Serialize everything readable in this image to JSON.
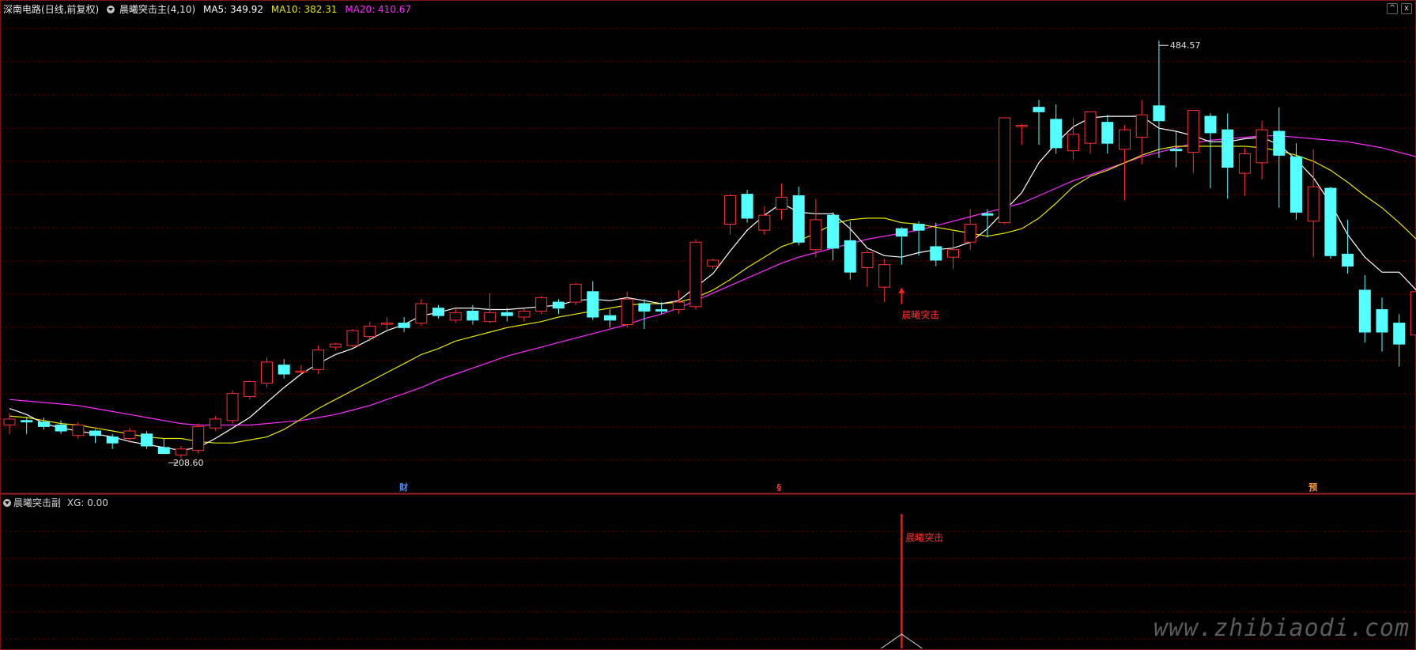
{
  "main_panel": {
    "stock_name": "深南电路",
    "period": "(日线,前复权)",
    "indicator_name": "晨曦突击主",
    "indicator_params": "(4,10)",
    "ma5_label": "MA5: 349.92",
    "ma10_label": "MA10: 382.31",
    "ma20_label": "MA20: 410.67",
    "high_label": "484.57",
    "low_label": "208.60",
    "signal_label": "晨曦突击",
    "markers": [
      {
        "text": "财",
        "color": "#4a8cff",
        "index": 23
      },
      {
        "text": "§",
        "color": "#ff3030",
        "index": 45
      },
      {
        "text": "预",
        "color": "#ff9a30",
        "index": 76
      }
    ],
    "colors": {
      "up": "#ff3030",
      "down": "#54ffff",
      "ma5": "#ffffff",
      "ma10": "#e6e600",
      "ma20": "#ff2cff",
      "grid": "#5a0000"
    }
  },
  "sub_panel": {
    "indicator_name": "晨曦突击副",
    "value_label": "XG: 0.00",
    "signal_label": "晨曦突击"
  },
  "window_buttons": {
    "collapse": "^",
    "close": "x"
  },
  "watermark": "www.zhibiaodi.com",
  "chart_data": {
    "type": "candlestick",
    "y_range": [
      195,
      500
    ],
    "signal_index": 52,
    "candles": [
      [
        228,
        232,
        222,
        236
      ],
      [
        231,
        230,
        222,
        233
      ],
      [
        230,
        227,
        225,
        233
      ],
      [
        228,
        224,
        222,
        231
      ],
      [
        221,
        228,
        219,
        230
      ],
      [
        224,
        221,
        216,
        225
      ],
      [
        220,
        216,
        212,
        222
      ],
      [
        219,
        224,
        216,
        226
      ],
      [
        222,
        214,
        212,
        224
      ],
      [
        213,
        209,
        208.6,
        219
      ],
      [
        208,
        212,
        206,
        214
      ],
      [
        211,
        227,
        209,
        229
      ],
      [
        226,
        232,
        224,
        234
      ],
      [
        231,
        249,
        229,
        251
      ],
      [
        247,
        257,
        245,
        258
      ],
      [
        256,
        270,
        253,
        273
      ],
      [
        268,
        262,
        259,
        272
      ],
      [
        264,
        264,
        262,
        268
      ],
      [
        265,
        278,
        262,
        281
      ],
      [
        280,
        282,
        278,
        283
      ],
      [
        281,
        291,
        280,
        292
      ],
      [
        287,
        294,
        284,
        297
      ],
      [
        296,
        296,
        290,
        300
      ],
      [
        296,
        293,
        290,
        300
      ],
      [
        296,
        309,
        294,
        312
      ],
      [
        306,
        301,
        299,
        308
      ],
      [
        298,
        303,
        296,
        306
      ],
      [
        304,
        298,
        295,
        308
      ],
      [
        297,
        303,
        296,
        316
      ],
      [
        303,
        301,
        297,
        306
      ],
      [
        300,
        304,
        297,
        306
      ],
      [
        304,
        313,
        302,
        314
      ],
      [
        310,
        306,
        302,
        312
      ],
      [
        310,
        322,
        308,
        323
      ],
      [
        317,
        300,
        298,
        324
      ],
      [
        301,
        298,
        293,
        305
      ],
      [
        295,
        312,
        293,
        317
      ],
      [
        309,
        304,
        292,
        312
      ],
      [
        305,
        304,
        302,
        310
      ],
      [
        305,
        310,
        302,
        318
      ],
      [
        307,
        350,
        305,
        352
      ],
      [
        334,
        338,
        332,
        339
      ],
      [
        362,
        381,
        355,
        382
      ],
      [
        382,
        366,
        363,
        385
      ],
      [
        358,
        368,
        355,
        374
      ],
      [
        372,
        380,
        365,
        389
      ],
      [
        381,
        350,
        348,
        387
      ],
      [
        345,
        365,
        340,
        379
      ],
      [
        368,
        346,
        338,
        370
      ],
      [
        351,
        330,
        325,
        364
      ],
      [
        333,
        343,
        320,
        345
      ],
      [
        320,
        335,
        310,
        339
      ],
      [
        359,
        354,
        335,
        360
      ],
      [
        362,
        358,
        341,
        364
      ],
      [
        347,
        338,
        334,
        363
      ],
      [
        340,
        345,
        332,
        357
      ],
      [
        350,
        362,
        345,
        372
      ],
      [
        369,
        368,
        353,
        372
      ],
      [
        363,
        433,
        362,
        433
      ],
      [
        428,
        428,
        415,
        429
      ],
      [
        440,
        437,
        415,
        445
      ],
      [
        432,
        413,
        409,
        442
      ],
      [
        411,
        422,
        405,
        433
      ],
      [
        416,
        437,
        409,
        437
      ],
      [
        430,
        416,
        409,
        435
      ],
      [
        412,
        425,
        378,
        428
      ],
      [
        420,
        435,
        402,
        445
      ],
      [
        441,
        431,
        406,
        484.57
      ],
      [
        412,
        411,
        400,
        424
      ],
      [
        410,
        438,
        396,
        438
      ],
      [
        434,
        423,
        386,
        436
      ],
      [
        425,
        400,
        379,
        436
      ],
      [
        396,
        409,
        381,
        413
      ],
      [
        403,
        425,
        392,
        431
      ],
      [
        424,
        408,
        373,
        440
      ],
      [
        407,
        370,
        365,
        416
      ],
      [
        364,
        387,
        340,
        412
      ],
      [
        386,
        341,
        339,
        387
      ],
      [
        342,
        334,
        329,
        365
      ],
      [
        318,
        290,
        283,
        328
      ],
      [
        305,
        290,
        277,
        313
      ],
      [
        296,
        282,
        267,
        302
      ],
      [
        288,
        317,
        250,
        313
      ]
    ],
    "ma5": [
      239,
      235,
      229,
      226,
      224,
      222,
      220,
      217,
      215,
      213,
      211,
      213,
      219,
      226,
      233,
      243,
      253,
      262,
      269,
      275,
      279,
      285,
      291,
      295,
      301,
      303,
      306,
      306,
      305,
      305,
      306,
      307,
      308,
      311,
      312,
      311,
      313,
      311,
      309,
      311,
      320,
      329,
      344,
      358,
      368,
      376,
      370,
      369,
      369,
      359,
      346,
      341,
      340,
      343,
      345,
      346,
      350,
      359,
      371,
      383,
      403,
      416,
      427,
      433,
      434,
      434,
      434,
      426,
      424,
      421,
      417,
      417,
      419,
      420,
      415,
      405,
      393,
      376,
      355,
      340,
      330,
      330,
      318
    ],
    "ma10": [
      234,
      233,
      231,
      229,
      228,
      226,
      224,
      222,
      220,
      219,
      219,
      217,
      216,
      216,
      218,
      220,
      225,
      232,
      239,
      245,
      251,
      257,
      263,
      269,
      275,
      279,
      284,
      287,
      290,
      293,
      295,
      297,
      300,
      302,
      304,
      306,
      308,
      309,
      309,
      310,
      313,
      318,
      325,
      333,
      340,
      347,
      351,
      356,
      362,
      365,
      366,
      366,
      363,
      362,
      360,
      358,
      356,
      354,
      356,
      359,
      366,
      376,
      387,
      394,
      398,
      403,
      408,
      412,
      414,
      414,
      414,
      414,
      414,
      413,
      411,
      408,
      404,
      398,
      390,
      381,
      373,
      363,
      352
    ],
    "ma20": [
      245,
      244,
      243,
      242,
      241,
      239,
      237,
      235,
      233,
      231,
      229,
      228,
      228,
      228,
      228,
      229,
      230,
      231,
      233,
      235,
      238,
      241,
      245,
      249,
      253,
      258,
      262,
      266,
      270,
      274,
      277,
      280,
      283,
      286,
      289,
      292,
      295,
      299,
      302,
      306,
      311,
      316,
      321,
      326,
      331,
      336,
      340,
      343,
      346,
      349,
      352,
      354,
      356,
      358,
      361,
      364,
      367,
      370,
      373,
      376,
      381,
      386,
      391,
      395,
      399,
      403,
      407,
      410,
      413,
      416,
      418,
      419,
      420,
      421,
      421,
      420,
      419,
      418,
      417,
      415,
      413,
      410,
      407
    ]
  }
}
